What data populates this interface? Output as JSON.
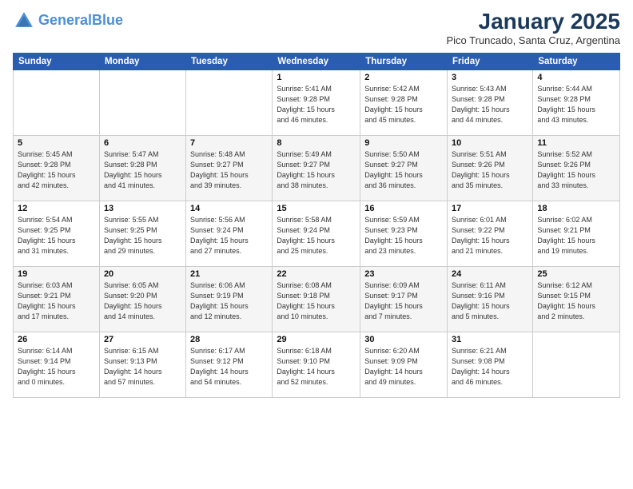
{
  "header": {
    "logo_line1": "General",
    "logo_line2": "Blue",
    "month": "January 2025",
    "location": "Pico Truncado, Santa Cruz, Argentina"
  },
  "weekdays": [
    "Sunday",
    "Monday",
    "Tuesday",
    "Wednesday",
    "Thursday",
    "Friday",
    "Saturday"
  ],
  "weeks": [
    [
      {
        "day": "",
        "info": ""
      },
      {
        "day": "",
        "info": ""
      },
      {
        "day": "",
        "info": ""
      },
      {
        "day": "1",
        "info": "Sunrise: 5:41 AM\nSunset: 9:28 PM\nDaylight: 15 hours\nand 46 minutes."
      },
      {
        "day": "2",
        "info": "Sunrise: 5:42 AM\nSunset: 9:28 PM\nDaylight: 15 hours\nand 45 minutes."
      },
      {
        "day": "3",
        "info": "Sunrise: 5:43 AM\nSunset: 9:28 PM\nDaylight: 15 hours\nand 44 minutes."
      },
      {
        "day": "4",
        "info": "Sunrise: 5:44 AM\nSunset: 9:28 PM\nDaylight: 15 hours\nand 43 minutes."
      }
    ],
    [
      {
        "day": "5",
        "info": "Sunrise: 5:45 AM\nSunset: 9:28 PM\nDaylight: 15 hours\nand 42 minutes."
      },
      {
        "day": "6",
        "info": "Sunrise: 5:47 AM\nSunset: 9:28 PM\nDaylight: 15 hours\nand 41 minutes."
      },
      {
        "day": "7",
        "info": "Sunrise: 5:48 AM\nSunset: 9:27 PM\nDaylight: 15 hours\nand 39 minutes."
      },
      {
        "day": "8",
        "info": "Sunrise: 5:49 AM\nSunset: 9:27 PM\nDaylight: 15 hours\nand 38 minutes."
      },
      {
        "day": "9",
        "info": "Sunrise: 5:50 AM\nSunset: 9:27 PM\nDaylight: 15 hours\nand 36 minutes."
      },
      {
        "day": "10",
        "info": "Sunrise: 5:51 AM\nSunset: 9:26 PM\nDaylight: 15 hours\nand 35 minutes."
      },
      {
        "day": "11",
        "info": "Sunrise: 5:52 AM\nSunset: 9:26 PM\nDaylight: 15 hours\nand 33 minutes."
      }
    ],
    [
      {
        "day": "12",
        "info": "Sunrise: 5:54 AM\nSunset: 9:25 PM\nDaylight: 15 hours\nand 31 minutes."
      },
      {
        "day": "13",
        "info": "Sunrise: 5:55 AM\nSunset: 9:25 PM\nDaylight: 15 hours\nand 29 minutes."
      },
      {
        "day": "14",
        "info": "Sunrise: 5:56 AM\nSunset: 9:24 PM\nDaylight: 15 hours\nand 27 minutes."
      },
      {
        "day": "15",
        "info": "Sunrise: 5:58 AM\nSunset: 9:24 PM\nDaylight: 15 hours\nand 25 minutes."
      },
      {
        "day": "16",
        "info": "Sunrise: 5:59 AM\nSunset: 9:23 PM\nDaylight: 15 hours\nand 23 minutes."
      },
      {
        "day": "17",
        "info": "Sunrise: 6:01 AM\nSunset: 9:22 PM\nDaylight: 15 hours\nand 21 minutes."
      },
      {
        "day": "18",
        "info": "Sunrise: 6:02 AM\nSunset: 9:21 PM\nDaylight: 15 hours\nand 19 minutes."
      }
    ],
    [
      {
        "day": "19",
        "info": "Sunrise: 6:03 AM\nSunset: 9:21 PM\nDaylight: 15 hours\nand 17 minutes."
      },
      {
        "day": "20",
        "info": "Sunrise: 6:05 AM\nSunset: 9:20 PM\nDaylight: 15 hours\nand 14 minutes."
      },
      {
        "day": "21",
        "info": "Sunrise: 6:06 AM\nSunset: 9:19 PM\nDaylight: 15 hours\nand 12 minutes."
      },
      {
        "day": "22",
        "info": "Sunrise: 6:08 AM\nSunset: 9:18 PM\nDaylight: 15 hours\nand 10 minutes."
      },
      {
        "day": "23",
        "info": "Sunrise: 6:09 AM\nSunset: 9:17 PM\nDaylight: 15 hours\nand 7 minutes."
      },
      {
        "day": "24",
        "info": "Sunrise: 6:11 AM\nSunset: 9:16 PM\nDaylight: 15 hours\nand 5 minutes."
      },
      {
        "day": "25",
        "info": "Sunrise: 6:12 AM\nSunset: 9:15 PM\nDaylight: 15 hours\nand 2 minutes."
      }
    ],
    [
      {
        "day": "26",
        "info": "Sunrise: 6:14 AM\nSunset: 9:14 PM\nDaylight: 15 hours\nand 0 minutes."
      },
      {
        "day": "27",
        "info": "Sunrise: 6:15 AM\nSunset: 9:13 PM\nDaylight: 14 hours\nand 57 minutes."
      },
      {
        "day": "28",
        "info": "Sunrise: 6:17 AM\nSunset: 9:12 PM\nDaylight: 14 hours\nand 54 minutes."
      },
      {
        "day": "29",
        "info": "Sunrise: 6:18 AM\nSunset: 9:10 PM\nDaylight: 14 hours\nand 52 minutes."
      },
      {
        "day": "30",
        "info": "Sunrise: 6:20 AM\nSunset: 9:09 PM\nDaylight: 14 hours\nand 49 minutes."
      },
      {
        "day": "31",
        "info": "Sunrise: 6:21 AM\nSunset: 9:08 PM\nDaylight: 14 hours\nand 46 minutes."
      },
      {
        "day": "",
        "info": ""
      }
    ]
  ]
}
